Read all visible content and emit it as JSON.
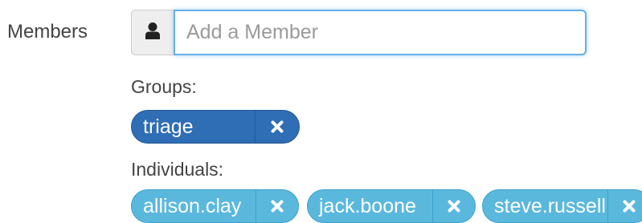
{
  "members": {
    "label": "Members",
    "input": {
      "placeholder": "Add a Member",
      "value": "",
      "icon": "user-icon"
    }
  },
  "groups": {
    "label": "Groups:",
    "items": [
      {
        "name": "triage",
        "remove_icon": "close-icon"
      }
    ]
  },
  "individuals": {
    "label": "Individuals:",
    "items": [
      {
        "name": "allison.clay",
        "remove_icon": "close-icon"
      },
      {
        "name": "jack.boone",
        "remove_icon": "close-icon"
      },
      {
        "name": "steve.russell",
        "remove_icon": "close-icon"
      }
    ]
  },
  "colors": {
    "group_tag": "#2f6db5",
    "individual_tag": "#5bb8dd",
    "input_focus_border": "#66afe9",
    "addon_background": "#eeeeee"
  }
}
